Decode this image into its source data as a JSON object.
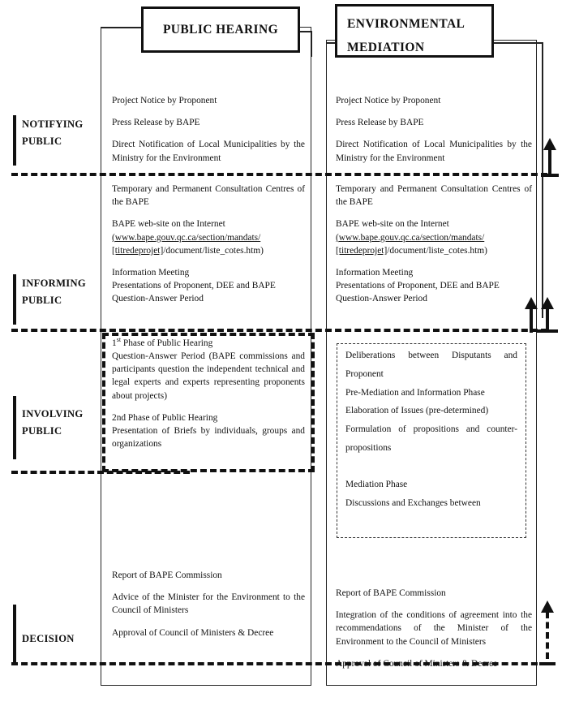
{
  "diagram": {
    "title_boxes": {
      "public_hearing": "PUBLIC HEARING",
      "environmental_mediation_line1": "ENVIRONMENTAL",
      "environmental_mediation_line2": "MEDIATION"
    },
    "stages": [
      {
        "id": "notifying",
        "label": "NOTIFYING\nPUBLIC"
      },
      {
        "id": "informing",
        "label": "INFORMING\nPUBLIC"
      },
      {
        "id": "involving",
        "label": "INVOLVING\nPUBLIC"
      },
      {
        "id": "decision",
        "label": "DECISION"
      }
    ],
    "public_hearing": {
      "notifying": [
        "Project Notice by Proponent",
        "Press Release by BAPE",
        "Direct Notification of Local Municipalities by the Ministry for the Environment"
      ],
      "informing": [
        "Temporary and Permanent Consultation Centres of the BAPE",
        "BAPE web-site on the Internet",
        "(www.bape.gouv.qc.ca/section/mandats/",
        "[titredeprojet]/document/liste_cotes.htm)",
        "Information Meeting",
        "Presentations of Proponent, DEE and BAPE",
        "Question-Answer Period"
      ],
      "involving": [
        "1st Phase of Public Hearing",
        "Question-Answer Period (BAPE commissions and participants question the independent technical and legal experts and experts representing proponents about projects)",
        "2nd Phase of Public Hearing",
        "Presentation of Briefs by individuals, groups and organizations"
      ],
      "decision": [
        "Report of BAPE Commission",
        "Advice of the Minister for the Environment to the Council of Ministers",
        "Approval of Council of Ministers & Decree"
      ]
    },
    "environmental_mediation": {
      "notifying": [
        "Project Notice by Proponent",
        "Press Release by BAPE",
        "Direct Notification of Local Municipalities by the Ministry for the Environment"
      ],
      "informing": [
        "Temporary and Permanent Consultation Centres of the BAPE",
        "BAPE web-site on the Internet",
        "(www.bape.gouv.qc.ca/section/mandats/",
        "[titredeprojet]/document/liste_cotes.htm)",
        "Information Meeting",
        "Presentations of Proponent, DEE and BAPE",
        "Question-Answer Period"
      ],
      "involving": [
        "Deliberations between Disputants and Proponent",
        "Pre-Mediation and Information Phase",
        "Elaboration of Issues (pre-determined)",
        "Formulation of propositions and counter-propositions",
        "Mediation Phase",
        "Discussions and Exchanges between"
      ],
      "decision": [
        "Report of BAPE Commission",
        "Integration of the conditions of agreement into the recommendations of the Minister of the Environment to the Council of Ministers",
        "Approval of Council of Ministers & Decree"
      ]
    },
    "colors": {
      "line": "#222222",
      "text": "#111111",
      "background": "#ffffff"
    }
  }
}
